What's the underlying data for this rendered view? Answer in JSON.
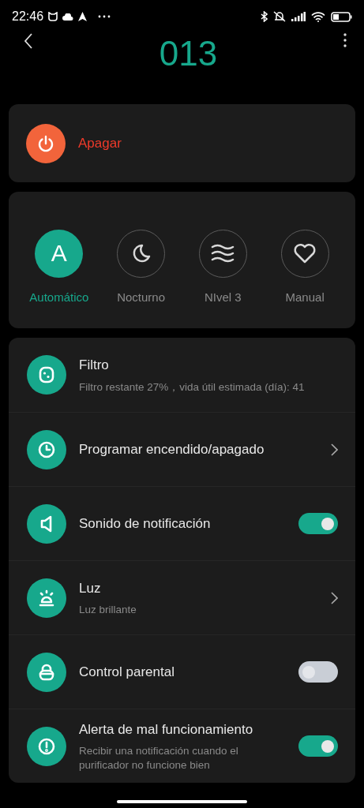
{
  "status_bar": {
    "time": "22:46"
  },
  "header": {
    "title": "013"
  },
  "power": {
    "label": "Apagar",
    "on": true
  },
  "modes": [
    {
      "label": "Automático",
      "selected": true,
      "kind": "letter",
      "letter": "A"
    },
    {
      "label": "Nocturno",
      "selected": false,
      "kind": "moon"
    },
    {
      "label": "NIvel 3",
      "selected": false,
      "kind": "waves"
    },
    {
      "label": "Manual",
      "selected": false,
      "kind": "heart"
    }
  ],
  "settings": [
    {
      "kind": "info",
      "title": "Filtro",
      "subtitle": "Filtro restante 27%，vida útil estimada (día): 41"
    },
    {
      "kind": "link",
      "title": "Programar encendido/apagado"
    },
    {
      "kind": "toggle",
      "title": "Sonido de notificación",
      "on": true
    },
    {
      "kind": "link",
      "title": "Luz",
      "subtitle": "Luz brillante"
    },
    {
      "kind": "toggle",
      "title": "Control parental",
      "on": false
    },
    {
      "kind": "toggle",
      "title": "Alerta de mal funcionamiento",
      "subtitle": "Recibir una notificación cuando el purificador no funcione bien",
      "on": true
    }
  ]
}
